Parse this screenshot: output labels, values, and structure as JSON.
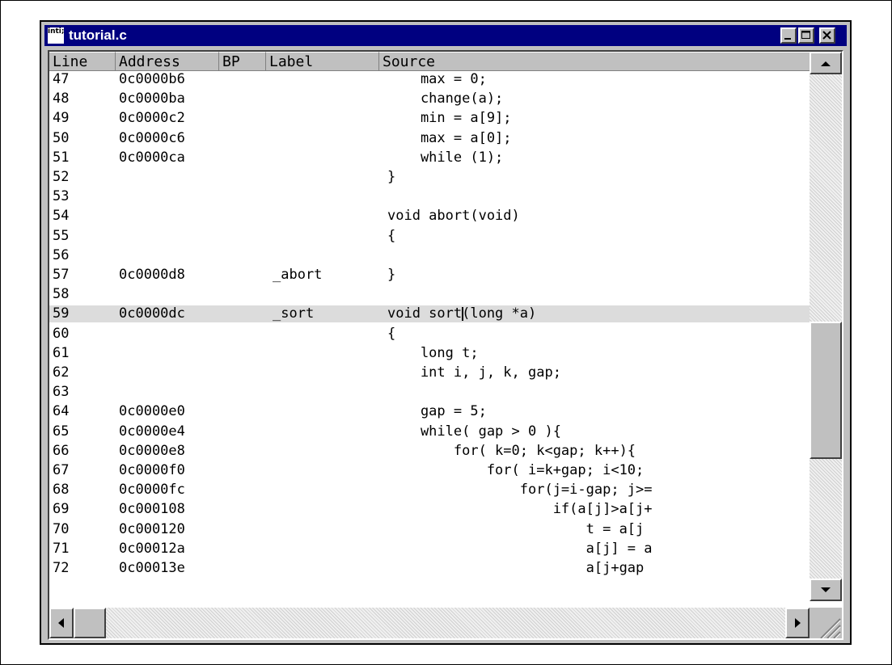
{
  "window": {
    "title": "tutorial.c",
    "icon": "inti-app-icon",
    "icon_text": "inti;"
  },
  "columns": {
    "line": "Line",
    "address": "Address",
    "bp": "BP",
    "label": "Label",
    "source": "Source"
  },
  "rows": [
    {
      "line": "47",
      "addr": "0c0000b6",
      "label": "",
      "src": "    max = 0;"
    },
    {
      "line": "48",
      "addr": "0c0000ba",
      "label": "",
      "src": "    change(a);"
    },
    {
      "line": "49",
      "addr": "0c0000c2",
      "label": "",
      "src": "    min = a[9];"
    },
    {
      "line": "50",
      "addr": "0c0000c6",
      "label": "",
      "src": "    max = a[0];"
    },
    {
      "line": "51",
      "addr": "0c0000ca",
      "label": "",
      "src": "    while (1);"
    },
    {
      "line": "52",
      "addr": "",
      "label": "",
      "src": "}"
    },
    {
      "line": "53",
      "addr": "",
      "label": "",
      "src": ""
    },
    {
      "line": "54",
      "addr": "",
      "label": "",
      "src": "void abort(void)"
    },
    {
      "line": "55",
      "addr": "",
      "label": "",
      "src": "{"
    },
    {
      "line": "56",
      "addr": "",
      "label": "",
      "src": ""
    },
    {
      "line": "57",
      "addr": "0c0000d8",
      "label": "_abort",
      "src": "}"
    },
    {
      "line": "58",
      "addr": "",
      "label": "",
      "src": ""
    },
    {
      "line": "59",
      "addr": "0c0000dc",
      "label": "_sort",
      "src": "void sort(long *a)",
      "selected": true
    },
    {
      "line": "60",
      "addr": "",
      "label": "",
      "src": "{"
    },
    {
      "line": "61",
      "addr": "",
      "label": "",
      "src": "    long t;"
    },
    {
      "line": "62",
      "addr": "",
      "label": "",
      "src": "    int i, j, k, gap;"
    },
    {
      "line": "63",
      "addr": "",
      "label": "",
      "src": ""
    },
    {
      "line": "64",
      "addr": "0c0000e0",
      "label": "",
      "src": "    gap = 5;"
    },
    {
      "line": "65",
      "addr": "0c0000e4",
      "label": "",
      "src": "    while( gap > 0 ){"
    },
    {
      "line": "66",
      "addr": "0c0000e8",
      "label": "",
      "src": "        for( k=0; k<gap; k++){"
    },
    {
      "line": "67",
      "addr": "0c0000f0",
      "label": "",
      "src": "            for( i=k+gap; i<10;"
    },
    {
      "line": "68",
      "addr": "0c0000fc",
      "label": "",
      "src": "                for(j=i-gap; j>="
    },
    {
      "line": "69",
      "addr": "0c000108",
      "label": "",
      "src": "                    if(a[j]>a[j+"
    },
    {
      "line": "70",
      "addr": "0c000120",
      "label": "",
      "src": "                        t = a[j"
    },
    {
      "line": "71",
      "addr": "0c00012a",
      "label": "",
      "src": "                        a[j] = a"
    },
    {
      "line": "72",
      "addr": "0c00013e",
      "label": "",
      "src": "                        a[j+gap"
    }
  ],
  "colors": {
    "titlebar": "#000080",
    "selected_row": "#dcdcdc",
    "chrome": "#c0c0c0"
  }
}
